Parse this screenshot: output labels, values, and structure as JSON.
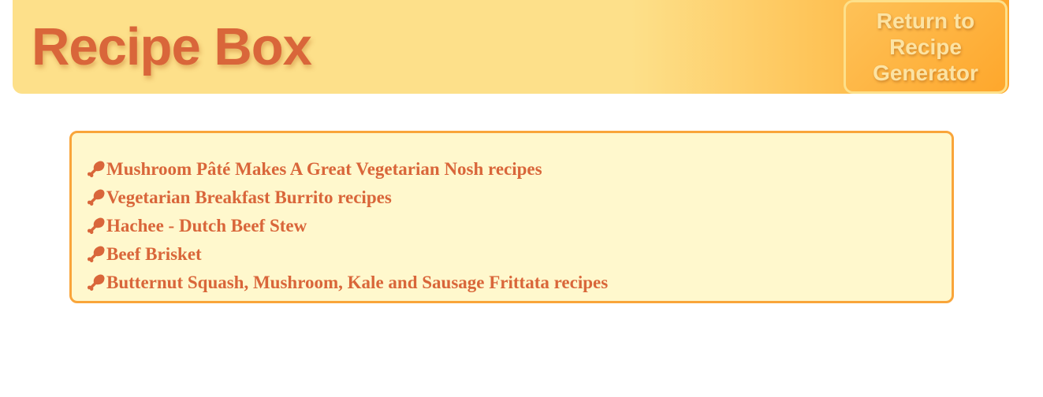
{
  "header": {
    "title": "Recipe Box",
    "return_button_label": "Return to Recipe Generator"
  },
  "recipes": {
    "icon": "drumstick-icon",
    "items": [
      {
        "label": "Mushroom Pâté Makes A Great Vegetarian Nosh recipes"
      },
      {
        "label": "Vegetarian Breakfast Burrito recipes"
      },
      {
        "label": "Hachee - Dutch Beef Stew"
      },
      {
        "label": "Beef Brisket"
      },
      {
        "label": "Butternut Squash, Mushroom, Kale and Sausage Frittata recipes"
      }
    ]
  },
  "colors": {
    "header_start": "#fde08a",
    "header_end": "#fea72c",
    "accent_text": "#d9663a",
    "box_background": "#fff8cd",
    "box_border": "#f9a53a"
  }
}
